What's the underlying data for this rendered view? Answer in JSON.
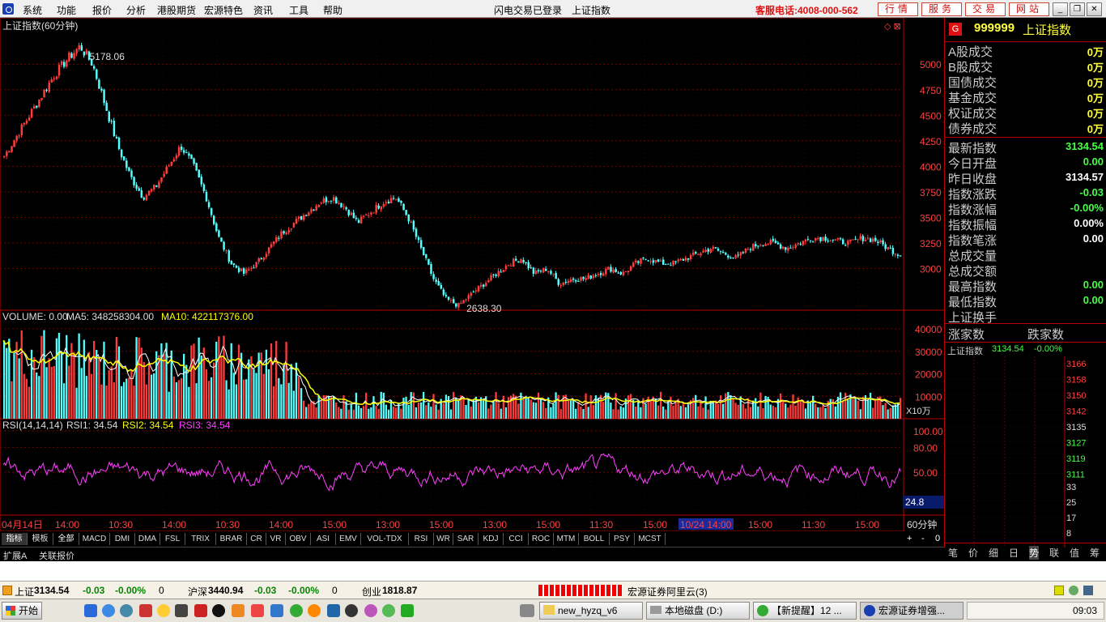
{
  "menubar": {
    "items": [
      "系统",
      "功能",
      "报价",
      "分析",
      "港股期货",
      "宏源特色",
      "资讯",
      "工具",
      "帮助"
    ],
    "login_status": "闪电交易已登录",
    "current": "上证指数",
    "hotline": "客服电话:4008-000-562",
    "buttons": [
      "行情",
      "服务",
      "交易",
      "网站"
    ]
  },
  "chart": {
    "title": "上证指数(60分钟)",
    "price_axis": [
      "5000",
      "4750",
      "4500",
      "4250",
      "4000",
      "3750",
      "3500",
      "3250",
      "3000"
    ],
    "high_marker": "5178.06",
    "low_marker": "2638.30",
    "volume_legend": {
      "vol": "VOLUME: 0.00",
      "ma5": "MA5: 348258304.00",
      "ma10": "MA10: 422117376.00"
    },
    "volume_axis": [
      "40000",
      "30000",
      "20000",
      "10000"
    ],
    "volume_unit": "X10万",
    "rsi_legend": {
      "params": "RSI(14,14,14)",
      "rsi1": "RSI1: 34.54",
      "rsi2": "RSI2: 34.54",
      "rsi3": "RSI3: 34.54"
    },
    "rsi_axis": [
      "100.00",
      "80.00",
      "50.00"
    ],
    "rsi_current": "24.8",
    "time_axis": [
      "04月14日",
      "14:00",
      "10:30",
      "14:00",
      "10:30",
      "14:00",
      "15:00",
      "13:00",
      "15:00",
      "13:00",
      "15:00",
      "11:30",
      "15:00",
      "10/24 14:00",
      "15:00",
      "11:30",
      "15:00"
    ],
    "period": "60分钟",
    "colors": {
      "up": "#ff3c3c",
      "down": "#54ffff",
      "ma5": "#ffffff",
      "ma10": "#ffff00",
      "rsi": "#ff40ff",
      "grid": "#7a0000"
    }
  },
  "chart_data": {
    "type": "candlestick",
    "price": [
      4100,
      4300,
      4500,
      4700,
      4900,
      5050,
      5178,
      5000,
      4600,
      4200,
      3900,
      3700,
      3800,
      4000,
      4200,
      4000,
      3700,
      3300,
      3050,
      2950,
      3050,
      3200,
      3350,
      3450,
      3550,
      3650,
      3700,
      3600,
      3450,
      3550,
      3650,
      3700,
      3500,
      3200,
      2900,
      2700,
      2638,
      2750,
      2850,
      2950,
      3050,
      3100,
      2950,
      3000,
      2850,
      2900,
      2900,
      2950,
      3000,
      2950,
      3050,
      3100,
      3050,
      3050,
      3100,
      3150,
      3200,
      3150,
      3100,
      3200,
      3250,
      3250,
      3200,
      3250,
      3300,
      3300,
      3270,
      3250,
      3300,
      3280,
      3200,
      3134
    ],
    "ylim": [
      2600,
      5200
    ],
    "volume_ylim": [
      0,
      40000
    ],
    "rsi_ylim": [
      0,
      100
    ]
  },
  "tabs": [
    "指标",
    "模板",
    "全部",
    "MACD",
    "DMI",
    "DMA",
    "FSL",
    "TRIX",
    "BRAR",
    "CR",
    "VR",
    "OBV",
    "ASI",
    "EMV",
    "VOL-TDX",
    "RSI",
    "WR",
    "SAR",
    "KDJ",
    "CCI",
    "ROC",
    "MTM",
    "BOLL",
    "PSY",
    "MCST"
  ],
  "ext_tabs": [
    "扩展A",
    "关联报价"
  ],
  "zoom_controls": [
    "+",
    "-",
    "0"
  ],
  "panel": {
    "code": "999999",
    "name": "上证指数",
    "g": "G",
    "turnover": [
      {
        "label": "A股成交",
        "value": "0万"
      },
      {
        "label": "B股成交",
        "value": "0万"
      },
      {
        "label": "国债成交",
        "value": "0万"
      },
      {
        "label": "基金成交",
        "value": "0万"
      },
      {
        "label": "权证成交",
        "value": "0万"
      },
      {
        "label": "债券成交",
        "value": "0万"
      }
    ],
    "stats": [
      {
        "label": "最新指数",
        "value": "3134.54",
        "color": "#44ff44"
      },
      {
        "label": "今日开盘",
        "value": "0.00",
        "color": "#44ff44"
      },
      {
        "label": "昨日收盘",
        "value": "3134.57",
        "color": "#ffffff"
      },
      {
        "label": "指数涨跌",
        "value": "-0.03",
        "color": "#44ff44"
      },
      {
        "label": "指数涨幅",
        "value": "-0.00%",
        "color": "#44ff44"
      },
      {
        "label": "指数振幅",
        "value": "0.00%",
        "color": "#ffffff"
      },
      {
        "label": "指数笔涨",
        "value": "0.00",
        "color": "#ffffff"
      },
      {
        "label": "总成交量",
        "value": "",
        "color": "#ffffff"
      },
      {
        "label": "总成交额",
        "value": "",
        "color": "#ffffff"
      },
      {
        "label": "最高指数",
        "value": "0.00",
        "color": "#44ff44"
      },
      {
        "label": "最低指数",
        "value": "0.00",
        "color": "#44ff44"
      },
      {
        "label": "上证换手",
        "value": "",
        "color": "#ffffff"
      }
    ],
    "breadth": {
      "up": "涨家数",
      "down": "跌家数"
    },
    "mini": {
      "name": "上证指数",
      "price": "3134.54",
      "change": "-0.00%",
      "axis": [
        "3166",
        "3158",
        "3150",
        "3142",
        "3135",
        "3127",
        "3119",
        "3111",
        "33",
        "25",
        "17",
        "8"
      ]
    },
    "bottom_tabs": [
      "笔",
      "价",
      "细",
      "日",
      "势",
      "联",
      "值",
      "筹"
    ]
  },
  "status": {
    "sh_label": "上证",
    "sh_value": "3134.54",
    "sh_chg": "-0.03",
    "sh_pct": "-0.00%",
    "sh_vol": "0",
    "hs_label": "沪深",
    "hs_value": "3440.94",
    "hs_chg": "-0.03",
    "hs_pct": "-0.00%",
    "hs_vol": "0",
    "cy_label": "创业",
    "cy_value": "1818.87",
    "broker": "宏源证券阿里云(3)"
  },
  "taskbar": {
    "start": "开始",
    "tasks": [
      "new_hyzq_v6",
      "本地磁盘 (D:)",
      "【新提醒】12 ...",
      "宏源证券增强..."
    ],
    "clock": "09:03"
  }
}
